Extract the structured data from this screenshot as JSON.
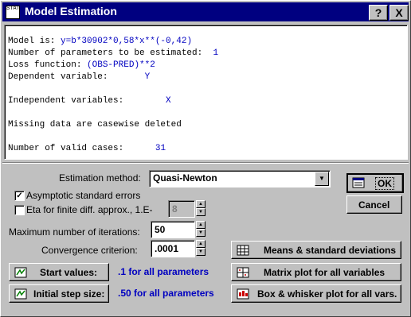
{
  "window": {
    "title": "Model Estimation",
    "app_icon_text": "STAT",
    "help_label": "?",
    "close_label": "X"
  },
  "info": {
    "model_label": "Model is: ",
    "model_value": "y=b*30902*0,58*x**(-0,42)",
    "nparams_label": "Number of parameters to be estimated:  ",
    "nparams_value": "1",
    "loss_label": "Loss function: ",
    "loss_value": "(OBS-PRED)**2",
    "dep_label": "Dependent variable:       ",
    "dep_value": "Y",
    "indep_label": "Independent variables:        ",
    "indep_value": "X",
    "missing_text": "Missing data are casewise deleted",
    "valid_label": "Number of valid cases:      ",
    "valid_value": "31"
  },
  "form": {
    "estimation_method_label": "Estimation method:",
    "estimation_method_value": "Quasi-Newton",
    "asymptotic_label": "Asymptotic standard errors",
    "asymptotic_checked": true,
    "eta_label": "Eta for finite diff. approx., 1.E-",
    "eta_checked": false,
    "eta_value": "8",
    "max_iter_label": "Maximum number of iterations:",
    "max_iter_value": "50",
    "convergence_label": "Convergence criterion:",
    "convergence_value": ".0001",
    "start_values_label": "Start values:",
    "start_values_text": ".1 for all parameters",
    "step_size_label": "Initial step size:",
    "step_size_text": ".50 for all parameters"
  },
  "buttons": {
    "ok": "OK",
    "cancel": "Cancel",
    "means": "Means & standard deviations",
    "matrix": "Matrix plot for all variables",
    "box": "Box & whisker plot for all vars."
  }
}
